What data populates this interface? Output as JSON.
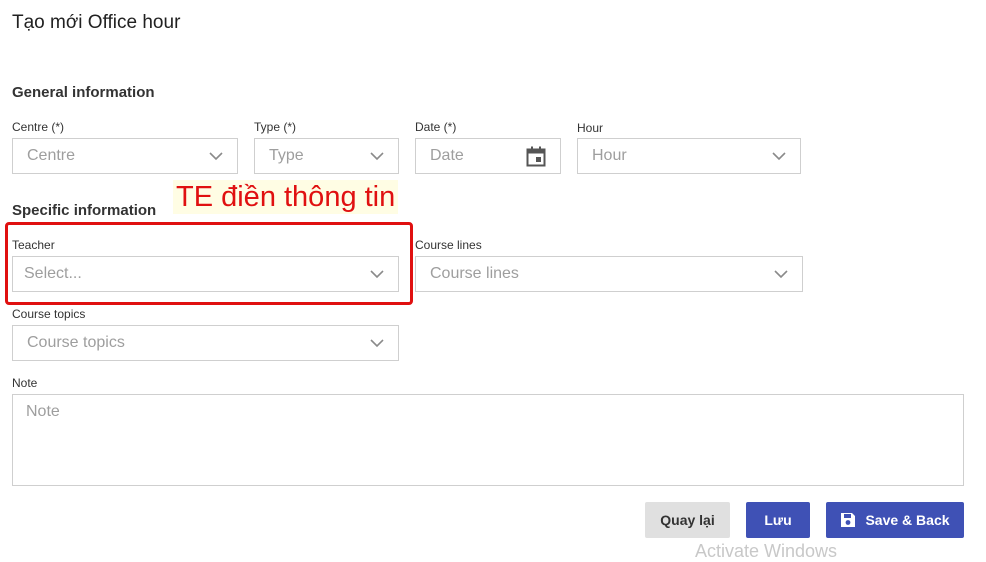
{
  "page": {
    "title": "Tạo mới Office hour"
  },
  "general": {
    "heading": "General information",
    "centre": {
      "label": "Centre (*)",
      "placeholder": "Centre"
    },
    "type": {
      "label": "Type (*)",
      "placeholder": "Type"
    },
    "date": {
      "label": "Date (*)",
      "placeholder": "Date"
    },
    "hour": {
      "label": "Hour",
      "placeholder": "Hour"
    }
  },
  "specific": {
    "heading": "Specific information",
    "teacher": {
      "label": "Teacher",
      "placeholder": "Select..."
    },
    "course_lines": {
      "label": "Course lines",
      "placeholder": "Course lines"
    },
    "course_topics": {
      "label": "Course topics",
      "placeholder": "Course topics"
    },
    "note": {
      "label": "Note",
      "placeholder": "Note"
    }
  },
  "annotation": {
    "text": "TE điền thông tin",
    "color": "#e01010"
  },
  "actions": {
    "back_label": "Quay lại",
    "save_label": "Lưu",
    "save_back_label": "Save & Back"
  },
  "watermark": {
    "text": "Activate Windows"
  },
  "colors": {
    "primary": "#3f51b5",
    "secondary": "#e0e0e0"
  }
}
